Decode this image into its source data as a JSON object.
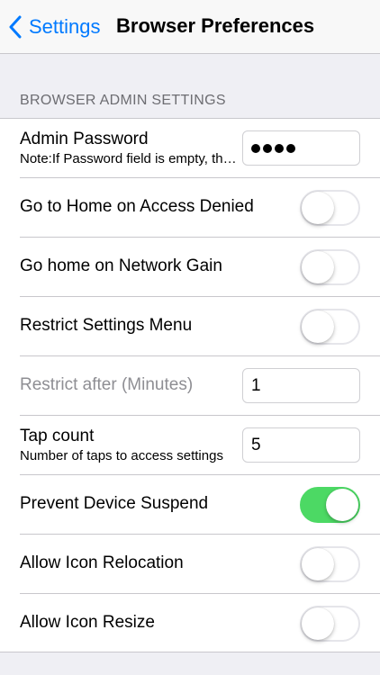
{
  "nav": {
    "back_label": "Settings",
    "title": "Browser Preferences"
  },
  "section": {
    "header": "BROWSER ADMIN SETTINGS"
  },
  "rows": {
    "admin_password": {
      "label": "Admin Password",
      "sublabel": "Note:If Password field is empty, the App Settings will be accessible",
      "masked_length": 4
    },
    "home_access_denied": {
      "label": "Go to Home on Access Denied",
      "on": false
    },
    "home_network_gain": {
      "label": "Go home on Network Gain",
      "on": false
    },
    "restrict_settings": {
      "label": "Restrict Settings Menu",
      "on": false
    },
    "restrict_after": {
      "label": "Restrict after (Minutes)",
      "value": "1"
    },
    "tap_count": {
      "label": "Tap count",
      "sublabel": "Number of taps to access settings",
      "value": "5"
    },
    "prevent_suspend": {
      "label": "Prevent Device Suspend",
      "on": true
    },
    "icon_relocation": {
      "label": "Allow Icon Relocation",
      "on": false
    },
    "icon_resize": {
      "label": "Allow Icon Resize",
      "on": false
    }
  },
  "colors": {
    "accent": "#007aff",
    "toggle_on": "#4cd964",
    "background": "#efeff4"
  }
}
